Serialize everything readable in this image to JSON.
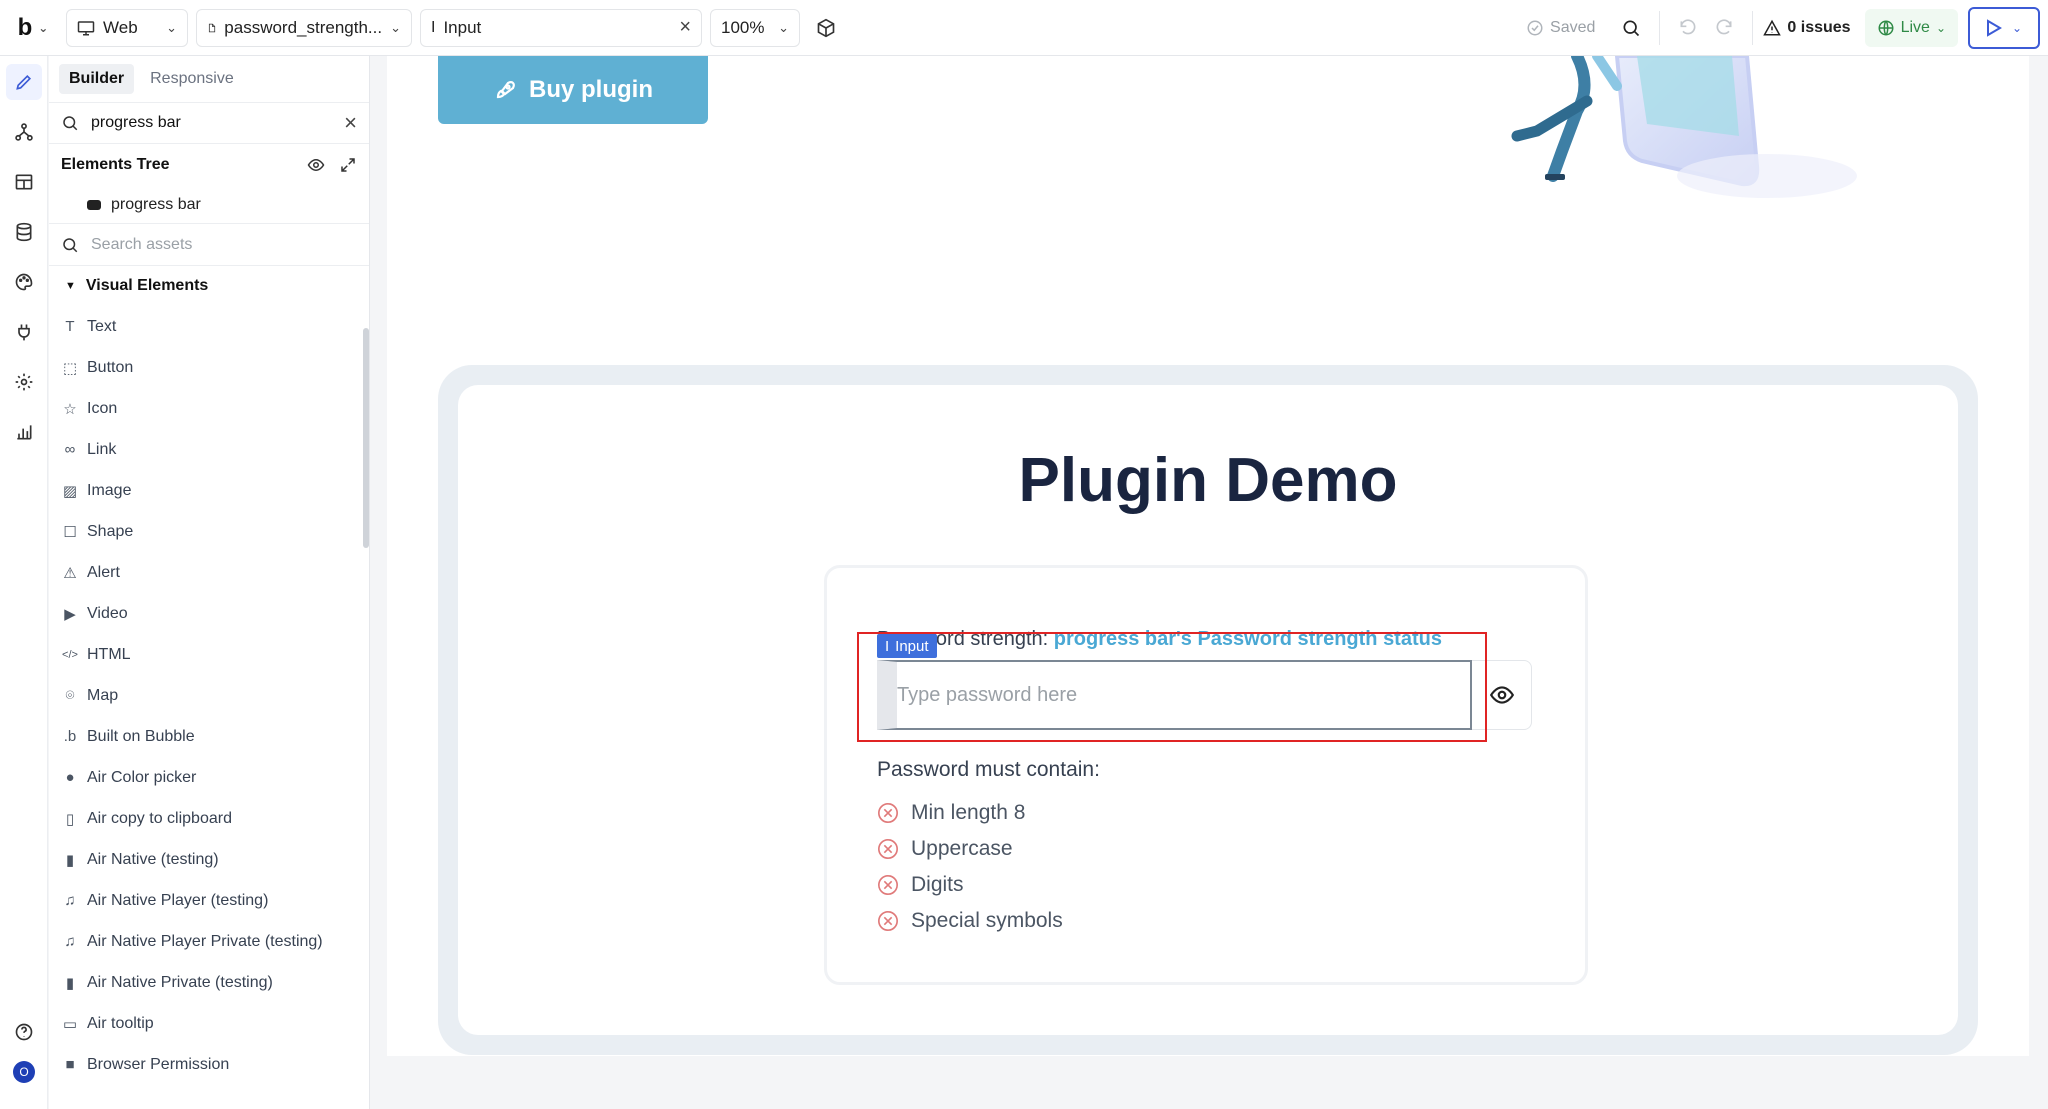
{
  "topbar": {
    "logo": "b",
    "device": "Web",
    "page": "password_strength...",
    "element": "Input",
    "zoom": "100%",
    "saved": "Saved",
    "issues": "0 issues",
    "live": "Live"
  },
  "rail": {
    "avatar": "O"
  },
  "panel": {
    "tabs": [
      "Builder",
      "Responsive"
    ],
    "search_value": "progress bar",
    "tree_title": "Elements Tree",
    "tree_item": "progress bar",
    "assets_placeholder": "Search assets",
    "section": "Visual Elements",
    "elements": [
      {
        "label": "Text",
        "icon": "text-icon"
      },
      {
        "label": "Button",
        "icon": "button-icon"
      },
      {
        "label": "Icon",
        "icon": "star-icon"
      },
      {
        "label": "Link",
        "icon": "link-icon"
      },
      {
        "label": "Image",
        "icon": "image-icon"
      },
      {
        "label": "Shape",
        "icon": "square-icon"
      },
      {
        "label": "Alert",
        "icon": "alert-icon"
      },
      {
        "label": "Video",
        "icon": "video-icon"
      },
      {
        "label": "HTML",
        "icon": "code-icon"
      },
      {
        "label": "Map",
        "icon": "map-pin-icon"
      },
      {
        "label": "Built on Bubble",
        "icon": "bubble-icon"
      },
      {
        "label": "Air Color picker",
        "icon": "palette-icon"
      },
      {
        "label": "Air copy to clipboard",
        "icon": "clipboard-icon"
      },
      {
        "label": "Air Native (testing)",
        "icon": "phone-icon"
      },
      {
        "label": "Air Native Player (testing)",
        "icon": "music-icon"
      },
      {
        "label": "Air Native Player Private (testing)",
        "icon": "music-icon"
      },
      {
        "label": "Air Native Private (testing)",
        "icon": "phone-icon"
      },
      {
        "label": "Air tooltip",
        "icon": "tooltip-icon"
      },
      {
        "label": "Browser Permission",
        "icon": "square-filled-icon"
      }
    ]
  },
  "canvas": {
    "buy_button": "Buy plugin",
    "demo_title": "Plugin Demo",
    "strength_label": "Password strength:",
    "strength_status": "progress bar's Password strength status",
    "input_tag": "Input",
    "input_placeholder": "Type password here",
    "must_contain": "Password must contain:",
    "rules": [
      "Min length 8",
      "Uppercase",
      "Digits",
      "Special symbols"
    ]
  },
  "colors": {
    "accent": "#3c5bd6",
    "buy_button": "#5fb0d3",
    "status_text": "#4aa8d4",
    "selection": "#e02424",
    "rule_icon": "#e07a7a",
    "live_green": "#2f8a46"
  }
}
